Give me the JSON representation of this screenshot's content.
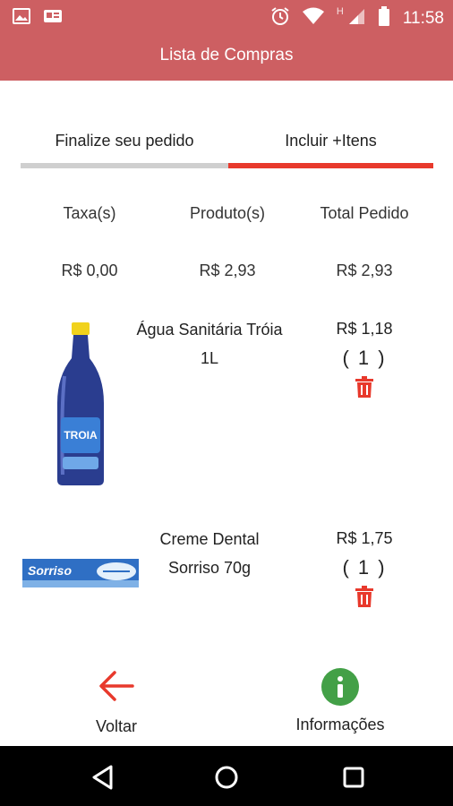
{
  "statusbar": {
    "time": "11:58",
    "network_label": "H"
  },
  "appbar": {
    "title": "Lista de Compras"
  },
  "tabs": [
    {
      "label": "Finalize seu pedido",
      "selected": false
    },
    {
      "label": "Incluir +Itens",
      "selected": true
    }
  ],
  "summary": {
    "headers": [
      "Taxa(s)",
      "Produto(s)",
      "Total Pedido"
    ],
    "values": [
      "R$ 0,00",
      "R$ 2,93",
      "R$ 2,93"
    ]
  },
  "items": [
    {
      "name_line1": "Água Sanitária Tróia",
      "name_line2": "1L",
      "price": "R$ 1,18",
      "qty": "( 1 )",
      "image_icon": "bleach-bottle-icon",
      "brand_label": "TROIA"
    },
    {
      "name_line1": "Creme Dental",
      "name_line2": "Sorriso 70g",
      "price": "R$ 1,75",
      "qty": "( 1 )",
      "image_icon": "toothpaste-icon",
      "brand_label": "Sorriso"
    }
  ],
  "bottom": {
    "back_label": "Voltar",
    "info_label": "Informações"
  },
  "colors": {
    "primary": "#cd5f62",
    "accent": "#e8392c",
    "info": "#43a047"
  }
}
